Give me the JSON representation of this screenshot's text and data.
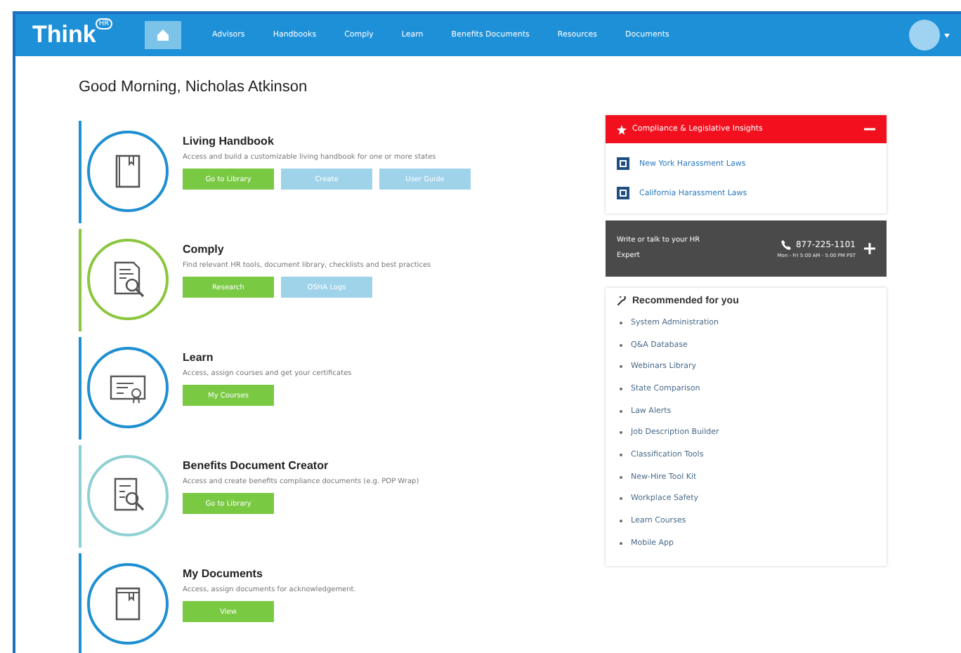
{
  "nav": {
    "logo": "Think",
    "logo_badge": "HR",
    "items": [
      {
        "label": "Advisors",
        "selected": false
      },
      {
        "label": "Handbooks",
        "selected": false
      },
      {
        "label": "Comply",
        "selected": false
      },
      {
        "label": "Learn",
        "selected": false
      },
      {
        "label": "Benefits Documents",
        "selected": false
      },
      {
        "label": "Resources",
        "selected": false
      },
      {
        "label": "Documents",
        "selected": false
      }
    ]
  },
  "greeting": "Good Morning, Nicholas Atkinson",
  "cards": [
    {
      "title": "Living Handbook",
      "description": "Access and build a customizable living handbook for one or more states",
      "color": "#1e8fd0",
      "buttons": [
        {
          "label": "Go to Library",
          "kind": "primary"
        },
        {
          "label": "Create",
          "kind": "secondary"
        },
        {
          "label": "User Guide",
          "kind": "secondary"
        }
      ]
    },
    {
      "title": "Comply",
      "description": "Find relevant HR tools, document library, checklists and best practices",
      "color": "#8cc63f",
      "buttons": [
        {
          "label": "Research",
          "kind": "primary"
        },
        {
          "label": "OSHA Logs",
          "kind": "secondary"
        }
      ]
    },
    {
      "title": "Learn",
      "description": "Access, assign courses and get your certificates",
      "color": "#1e8fd0",
      "buttons": [
        {
          "label": "My Courses",
          "kind": "primary"
        }
      ]
    },
    {
      "title": "Benefits Document Creator",
      "description": "Access and create benefits compliance documents (e.g. POP Wrap)",
      "color": "#8fd0d4",
      "buttons": [
        {
          "label": "Go to Library",
          "kind": "primary"
        }
      ]
    },
    {
      "title": "My Documents",
      "description": "Access, assign documents for acknowledgement.",
      "color": "#1e8fd0",
      "buttons": [
        {
          "label": "View",
          "kind": "primary"
        }
      ]
    }
  ],
  "insights": {
    "title": "Compliance & Legislative Insights",
    "expanded": true,
    "links": [
      "New York Harassment Laws",
      "California Harassment Laws"
    ]
  },
  "expert": {
    "text": "Write or talk to your HR Expert",
    "phone": "877-225-1101",
    "hours": "Mon - Fri 5:00 AM - 5:00 PM PST"
  },
  "recommended": {
    "title": "Recommended for you",
    "items": [
      "System Administration",
      "Q&A Database",
      "Webinars Library",
      "State Comparison",
      "Law Alerts",
      "Job Description Builder",
      "Classification Tools",
      "New-Hire Tool Kit",
      "Workplace Safety",
      "Learn Courses",
      "Mobile App"
    ]
  }
}
